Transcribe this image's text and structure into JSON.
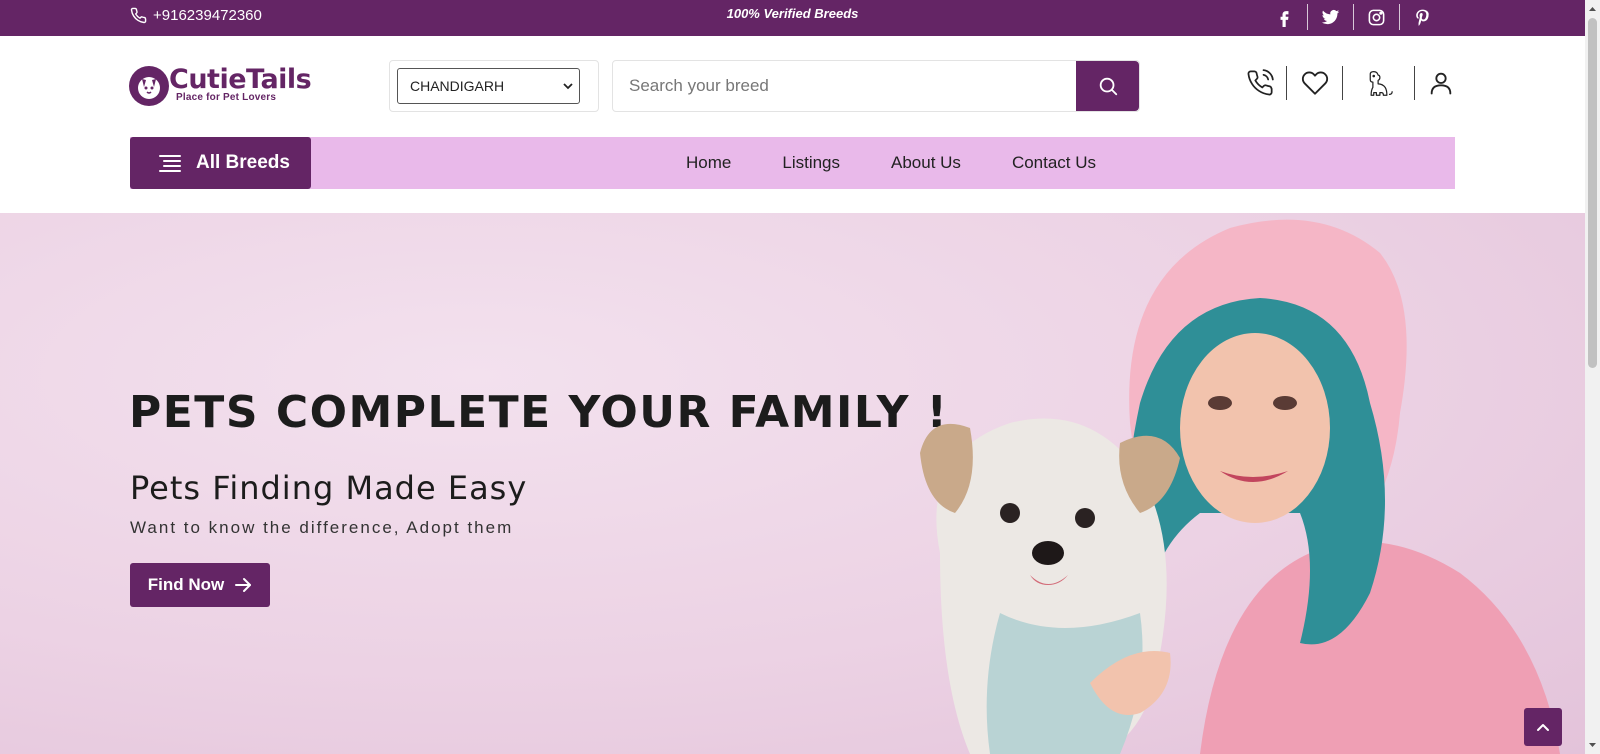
{
  "topbar": {
    "phone": "+916239472360",
    "tagline": "100% Verified Breeds",
    "social": [
      "facebook-icon",
      "twitter-icon",
      "instagram-icon",
      "pinterest-icon"
    ]
  },
  "header": {
    "logo_name": "CutieTails",
    "logo_tagline": "Place for Pet Lovers",
    "city_selected": "CHANDIGARH",
    "search_placeholder": "Search your breed",
    "icons": [
      "phone-icon",
      "heart-icon",
      "pet-icon",
      "user-icon"
    ]
  },
  "nav": {
    "all_breeds": "All Breeds",
    "links": [
      "Home",
      "Listings",
      "About Us",
      "Contact Us"
    ]
  },
  "hero": {
    "title": "PETS COMPLETE YOUR FAMILY !",
    "subtitle": "Pets Finding Made Easy",
    "text": "Want to know the difference, Adopt them",
    "cta": "Find Now"
  },
  "colors": {
    "brand": "#642565",
    "nav_bg": "#e9b9ea",
    "hero_bg": "#ecd2e4"
  }
}
